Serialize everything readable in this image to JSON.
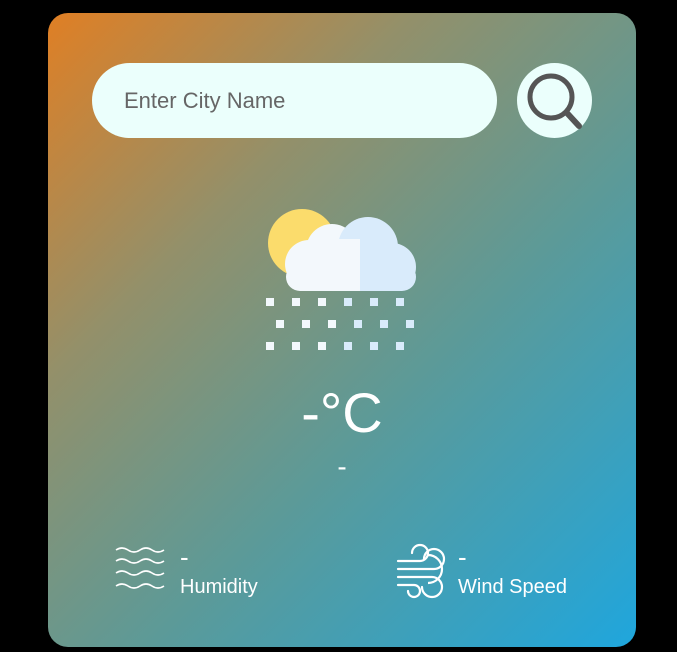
{
  "search": {
    "placeholder": "Enter City Name",
    "value": ""
  },
  "weather": {
    "icon": "snow-cloud-sun-icon",
    "temperature": "-°C",
    "city": "-"
  },
  "details": {
    "humidity": {
      "value": "-",
      "label": "Humidity",
      "icon": "humidity-waves-icon"
    },
    "wind": {
      "value": "-",
      "label": "Wind Speed",
      "icon": "wind-icon"
    }
  },
  "colors": {
    "gradient_start": "#e07f24",
    "gradient_end": "#1fa6dd",
    "input_bg": "#ebfffc",
    "text": "#ffffff"
  }
}
